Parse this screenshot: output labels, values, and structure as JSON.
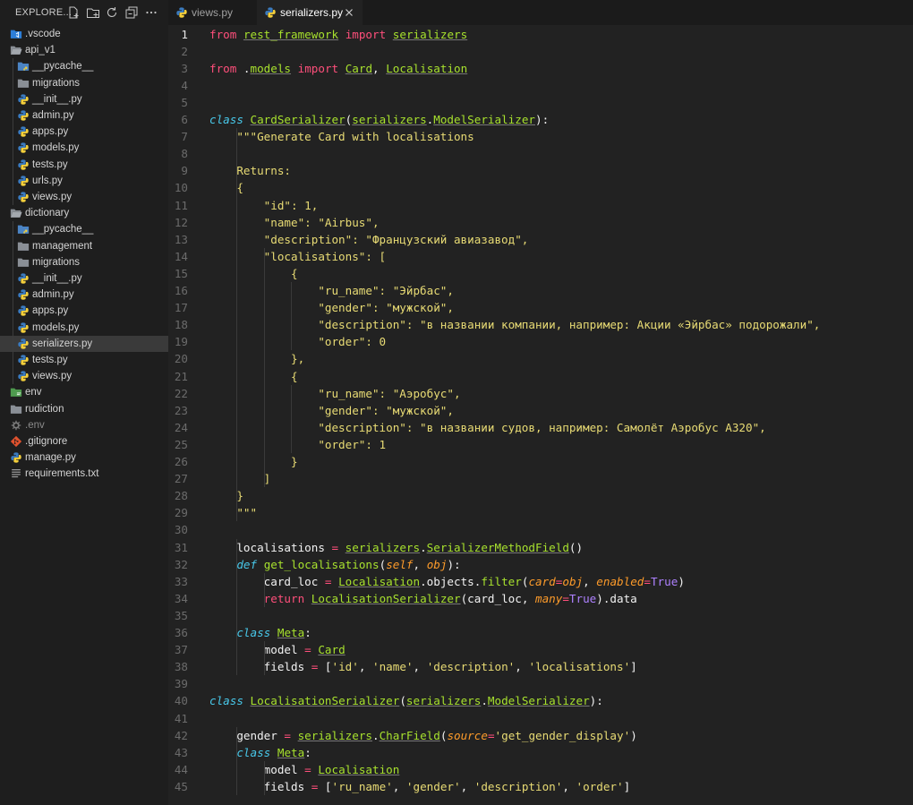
{
  "explorer": {
    "title": "EXPLORE...",
    "tree": [
      {
        "label": ".vscode",
        "icon": "vscode-folder-icon",
        "indent": 0
      },
      {
        "label": "api_v1",
        "icon": "folder-open-icon",
        "indent": 0
      },
      {
        "label": "__pycache__",
        "icon": "python-folder-icon",
        "indent": 1
      },
      {
        "label": "migrations",
        "icon": "folder-icon",
        "indent": 1
      },
      {
        "label": "__init__.py",
        "icon": "python-file-icon",
        "indent": 1
      },
      {
        "label": "admin.py",
        "icon": "python-file-icon",
        "indent": 1
      },
      {
        "label": "apps.py",
        "icon": "python-file-icon",
        "indent": 1
      },
      {
        "label": "models.py",
        "icon": "python-file-icon",
        "indent": 1
      },
      {
        "label": "tests.py",
        "icon": "python-file-icon",
        "indent": 1
      },
      {
        "label": "urls.py",
        "icon": "python-file-icon",
        "indent": 1
      },
      {
        "label": "views.py",
        "icon": "python-file-icon",
        "indent": 1
      },
      {
        "label": "dictionary",
        "icon": "folder-open-icon",
        "indent": 0
      },
      {
        "label": "__pycache__",
        "icon": "python-folder-icon",
        "indent": 1
      },
      {
        "label": "management",
        "icon": "folder-icon",
        "indent": 1
      },
      {
        "label": "migrations",
        "icon": "folder-icon",
        "indent": 1
      },
      {
        "label": "__init__.py",
        "icon": "python-file-icon",
        "indent": 1
      },
      {
        "label": "admin.py",
        "icon": "python-file-icon",
        "indent": 1
      },
      {
        "label": "apps.py",
        "icon": "python-file-icon",
        "indent": 1
      },
      {
        "label": "models.py",
        "icon": "python-file-icon",
        "indent": 1
      },
      {
        "label": "serializers.py",
        "icon": "python-file-icon",
        "indent": 1,
        "selected": true
      },
      {
        "label": "tests.py",
        "icon": "python-file-icon",
        "indent": 1
      },
      {
        "label": "views.py",
        "icon": "python-file-icon",
        "indent": 1
      },
      {
        "label": "env",
        "icon": "env-folder-icon",
        "indent": 0
      },
      {
        "label": "rudiction",
        "icon": "folder-icon",
        "indent": 0
      },
      {
        "label": ".env",
        "icon": "settings-file-icon",
        "indent": 0
      },
      {
        "label": ".gitignore",
        "icon": "git-icon",
        "indent": 0
      },
      {
        "label": "manage.py",
        "icon": "python-file-icon",
        "indent": 0
      },
      {
        "label": "requirements.txt",
        "icon": "text-file-icon",
        "indent": 0
      }
    ]
  },
  "tabs": [
    {
      "label": "views.py",
      "active": false
    },
    {
      "label": "serializers.py",
      "active": true
    }
  ],
  "current_line": 1,
  "code_lines": [
    [
      [
        "kw",
        "from"
      ],
      [
        "p",
        " "
      ],
      [
        "mod",
        "rest_framework"
      ],
      [
        "p",
        " "
      ],
      [
        "kw",
        "import"
      ],
      [
        "p",
        " "
      ],
      [
        "mod",
        "serializers"
      ]
    ],
    [],
    [
      [
        "kw",
        "from"
      ],
      [
        "p",
        " ."
      ],
      [
        "mod",
        "models"
      ],
      [
        "p",
        " "
      ],
      [
        "kw",
        "import"
      ],
      [
        "p",
        " "
      ],
      [
        "cls",
        "Card"
      ],
      [
        "p",
        ", "
      ],
      [
        "cls",
        "Localisation"
      ]
    ],
    [],
    [],
    [
      [
        "kwi",
        "class"
      ],
      [
        "p",
        " "
      ],
      [
        "cls",
        "CardSerializer"
      ],
      [
        "p",
        "("
      ],
      [
        "mod",
        "serializers"
      ],
      [
        "p",
        "."
      ],
      [
        "cls",
        "ModelSerializer"
      ],
      [
        "p",
        "):"
      ]
    ],
    [
      [
        "str",
        "    \"\"\"Generate Card with localisations"
      ]
    ],
    [],
    [
      [
        "str",
        "    Returns:"
      ]
    ],
    [
      [
        "str",
        "    {"
      ]
    ],
    [
      [
        "str",
        "        \"id\": 1,"
      ]
    ],
    [
      [
        "str",
        "        \"name\": \"Airbus\","
      ]
    ],
    [
      [
        "str",
        "        \"description\": \"Французский авиазавод\","
      ]
    ],
    [
      [
        "str",
        "        \"localisations\": ["
      ]
    ],
    [
      [
        "str",
        "            {"
      ]
    ],
    [
      [
        "str",
        "                \"ru_name\": \"Эйрбас\","
      ]
    ],
    [
      [
        "str",
        "                \"gender\": \"мужской\","
      ]
    ],
    [
      [
        "str",
        "                \"description\": \"в названии компании, например: Акции «Эйрбас» подорожали\","
      ]
    ],
    [
      [
        "str",
        "                \"order\": 0"
      ]
    ],
    [
      [
        "str",
        "            },"
      ]
    ],
    [
      [
        "str",
        "            {"
      ]
    ],
    [
      [
        "str",
        "                \"ru_name\": \"Аэробус\","
      ]
    ],
    [
      [
        "str",
        "                \"gender\": \"мужской\","
      ]
    ],
    [
      [
        "str",
        "                \"description\": \"в названии судов, например: Самолёт Аэробус А320\","
      ]
    ],
    [
      [
        "str",
        "                \"order\": 1"
      ]
    ],
    [
      [
        "str",
        "            }"
      ]
    ],
    [
      [
        "str",
        "        ]"
      ]
    ],
    [
      [
        "str",
        "    }"
      ]
    ],
    [
      [
        "str",
        "    \"\"\""
      ]
    ],
    [],
    [
      [
        "p",
        "    localisations "
      ],
      [
        "op",
        "="
      ],
      [
        "p",
        " "
      ],
      [
        "mod",
        "serializers"
      ],
      [
        "p",
        "."
      ],
      [
        "cls",
        "SerializerMethodField"
      ],
      [
        "p",
        "()"
      ]
    ],
    [
      [
        "p",
        "    "
      ],
      [
        "kwi",
        "def"
      ],
      [
        "p",
        " "
      ],
      [
        "fn",
        "get_localisations"
      ],
      [
        "p",
        "("
      ],
      [
        "param",
        "self"
      ],
      [
        "p",
        ", "
      ],
      [
        "param",
        "obj"
      ],
      [
        "p",
        "):"
      ]
    ],
    [
      [
        "p",
        "        card_loc "
      ],
      [
        "op",
        "="
      ],
      [
        "p",
        " "
      ],
      [
        "cls",
        "Localisation"
      ],
      [
        "p",
        ".objects."
      ],
      [
        "fn",
        "filter"
      ],
      [
        "p",
        "("
      ],
      [
        "param",
        "card"
      ],
      [
        "op",
        "="
      ],
      [
        "param",
        "obj"
      ],
      [
        "p",
        ", "
      ],
      [
        "param",
        "enabled"
      ],
      [
        "op",
        "="
      ],
      [
        "const",
        "True"
      ],
      [
        "p",
        ")"
      ]
    ],
    [
      [
        "p",
        "        "
      ],
      [
        "kw",
        "return"
      ],
      [
        "p",
        " "
      ],
      [
        "cls",
        "LocalisationSerializer"
      ],
      [
        "p",
        "(card_loc, "
      ],
      [
        "param",
        "many"
      ],
      [
        "op",
        "="
      ],
      [
        "const",
        "True"
      ],
      [
        "p",
        ").data"
      ]
    ],
    [],
    [
      [
        "p",
        "    "
      ],
      [
        "kwi",
        "class"
      ],
      [
        "p",
        " "
      ],
      [
        "cls",
        "Meta"
      ],
      [
        "p",
        ":"
      ]
    ],
    [
      [
        "p",
        "        model "
      ],
      [
        "op",
        "="
      ],
      [
        "p",
        " "
      ],
      [
        "cls",
        "Card"
      ]
    ],
    [
      [
        "p",
        "        fields "
      ],
      [
        "op",
        "="
      ],
      [
        "p",
        " ["
      ],
      [
        "str",
        "'id'"
      ],
      [
        "p",
        ", "
      ],
      [
        "str",
        "'name'"
      ],
      [
        "p",
        ", "
      ],
      [
        "str",
        "'description'"
      ],
      [
        "p",
        ", "
      ],
      [
        "str",
        "'localisations'"
      ],
      [
        "p",
        "]"
      ]
    ],
    [],
    [
      [
        "kwi",
        "class"
      ],
      [
        "p",
        " "
      ],
      [
        "cls",
        "LocalisationSerializer"
      ],
      [
        "p",
        "("
      ],
      [
        "mod",
        "serializers"
      ],
      [
        "p",
        "."
      ],
      [
        "cls",
        "ModelSerializer"
      ],
      [
        "p",
        "):"
      ]
    ],
    [],
    [
      [
        "p",
        "    gender "
      ],
      [
        "op",
        "="
      ],
      [
        "p",
        " "
      ],
      [
        "mod",
        "serializers"
      ],
      [
        "p",
        "."
      ],
      [
        "cls",
        "CharField"
      ],
      [
        "p",
        "("
      ],
      [
        "param",
        "source"
      ],
      [
        "op",
        "="
      ],
      [
        "str",
        "'get_gender_display'"
      ],
      [
        "p",
        ")"
      ]
    ],
    [
      [
        "p",
        "    "
      ],
      [
        "kwi",
        "class"
      ],
      [
        "p",
        " "
      ],
      [
        "cls",
        "Meta"
      ],
      [
        "p",
        ":"
      ]
    ],
    [
      [
        "p",
        "        model "
      ],
      [
        "op",
        "="
      ],
      [
        "p",
        " "
      ],
      [
        "cls",
        "Localisation"
      ]
    ],
    [
      [
        "p",
        "        fields "
      ],
      [
        "op",
        "="
      ],
      [
        "p",
        " ["
      ],
      [
        "str",
        "'ru_name'"
      ],
      [
        "p",
        ", "
      ],
      [
        "str",
        "'gender'"
      ],
      [
        "p",
        ", "
      ],
      [
        "str",
        "'description'"
      ],
      [
        "p",
        ", "
      ],
      [
        "str",
        "'order'"
      ],
      [
        "p",
        "]"
      ]
    ]
  ],
  "colors": {
    "background": "#222222",
    "keyword": "#ff4f7b",
    "string": "#e8db74",
    "class": "#a8e22e",
    "number": "#ae81ff",
    "param": "#fd9b2a",
    "italic_keyword": "#48c8ea"
  }
}
